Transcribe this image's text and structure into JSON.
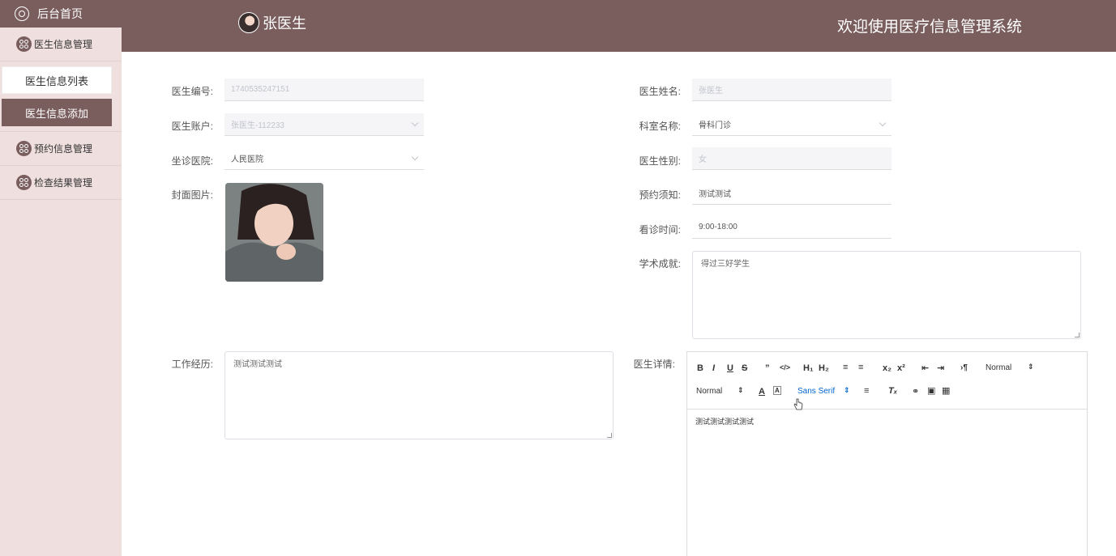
{
  "sidebar": {
    "home": "后台首页",
    "groups": [
      {
        "label": "医生信息管理"
      },
      {
        "label": "预约信息管理"
      },
      {
        "label": "检查结果管理"
      }
    ],
    "sub_items": [
      {
        "label": "医生信息列表"
      },
      {
        "label": "医生信息添加"
      }
    ]
  },
  "header": {
    "user_name": "张医生",
    "welcome": "欢迎使用医疗信息管理系统"
  },
  "form": {
    "doctor_no": {
      "label": "医生编号:",
      "value": "1740535247151"
    },
    "doctor_name": {
      "label": "医生姓名:",
      "value": "张医生"
    },
    "account": {
      "label": "医生账户:",
      "value": "张医生-112233"
    },
    "department": {
      "label": "科室名称:",
      "value": "骨科门诊"
    },
    "hospital": {
      "label": "坐诊医院:",
      "value": "人民医院"
    },
    "gender": {
      "label": "医生性别:",
      "value": "女"
    },
    "cover": {
      "label": "封面图片:"
    },
    "notice": {
      "label": "预约须知:",
      "value": "测试测试"
    },
    "hours": {
      "label": "看诊时间:",
      "value": "9:00-18:00"
    },
    "achievement": {
      "label": "学术成就:",
      "value": "得过三好学生"
    },
    "experience": {
      "label": "工作经历:",
      "value": "测试测试测试"
    },
    "detail": {
      "label": "医生详情:",
      "value": "测试测试测试测试"
    }
  },
  "editor": {
    "header_select": "Normal",
    "size_select": "Normal",
    "font_select": "Sans Serif"
  }
}
